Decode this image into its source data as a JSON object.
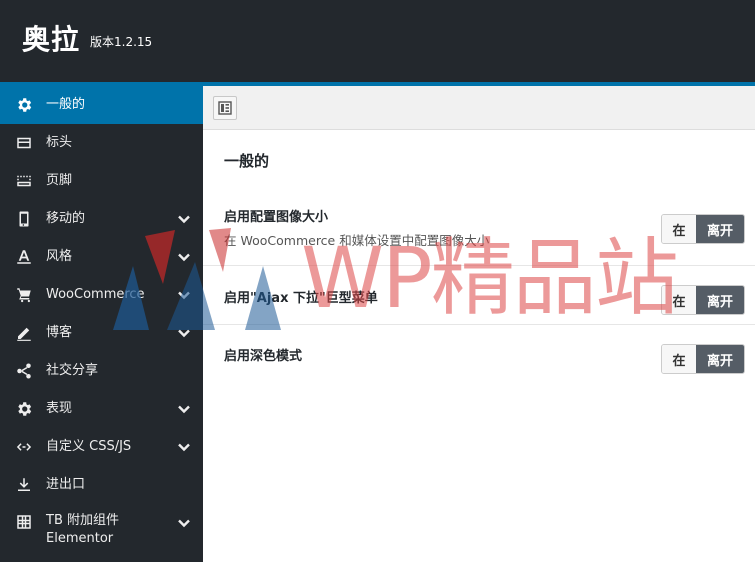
{
  "header": {
    "brand": "奥拉",
    "version": "版本1.2.15"
  },
  "sidebar": {
    "items": [
      {
        "label": "一般的",
        "icon": "gear-icon",
        "active": true,
        "has_chevron": false
      },
      {
        "label": "标头",
        "icon": "header-icon",
        "active": false,
        "has_chevron": false
      },
      {
        "label": "页脚",
        "icon": "footer-icon",
        "active": false,
        "has_chevron": false
      },
      {
        "label": "移动的",
        "icon": "mobile-icon",
        "active": false,
        "has_chevron": true
      },
      {
        "label": "风格",
        "icon": "text-style-icon",
        "active": false,
        "has_chevron": true
      },
      {
        "label": "WooCommerce",
        "icon": "cart-icon",
        "active": false,
        "has_chevron": true
      },
      {
        "label": "博客",
        "icon": "pencil-icon",
        "active": false,
        "has_chevron": true
      },
      {
        "label": "社交分享",
        "icon": "share-icon",
        "active": false,
        "has_chevron": false
      },
      {
        "label": "表现",
        "icon": "gear-icon",
        "active": false,
        "has_chevron": true
      },
      {
        "label": "自定义 CSS/JS",
        "icon": "code-icon",
        "active": false,
        "has_chevron": true
      },
      {
        "label": "进出口",
        "icon": "download-icon",
        "active": false,
        "has_chevron": false
      },
      {
        "label": "TB 附加组件",
        "label2": "Elementor",
        "icon": "grid-icon",
        "active": false,
        "has_chevron": true
      }
    ]
  },
  "main": {
    "toolbar_icon": "layout-icon",
    "section_title": "一般的",
    "options": [
      {
        "label": "启用配置图像大小",
        "description": "在 WooCommerce 和媒体设置中配置图像大小",
        "on": "在",
        "off": "离开"
      },
      {
        "label": "启用\"Ajax 下拉\"巨型菜单",
        "description": "",
        "on": "在",
        "off": "离开"
      },
      {
        "label": "启用深色模式",
        "description": "",
        "on": "在",
        "off": "离开"
      }
    ]
  },
  "watermark": {
    "text": "WP精品站"
  },
  "colors": {
    "header_bg": "#23282d",
    "accent": "#0073aa",
    "toggle_off": "#555d66"
  }
}
